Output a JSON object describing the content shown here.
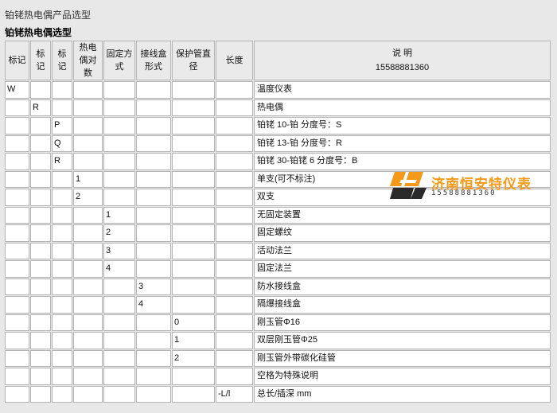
{
  "page_title": "铂铑热电偶产品选型",
  "sub_title": "铂铑热电偶选型",
  "headers": {
    "mark1": "标记",
    "mark2": "标记",
    "mark3": "标记",
    "pairs": "热电偶对数",
    "fixing": "固定方式",
    "junction": "接线盒形式",
    "tube": "保护管直径",
    "length": "长度",
    "desc_label": "说  明",
    "desc_phone": "15588881360"
  },
  "rows": [
    {
      "c1": "W",
      "c2": "",
      "c3": "",
      "c4": "",
      "c5": "",
      "c6": "",
      "c7": "",
      "c8": "",
      "desc": "温度仪表"
    },
    {
      "c1": "",
      "c2": "R",
      "c3": "",
      "c4": "",
      "c5": "",
      "c6": "",
      "c7": "",
      "c8": "",
      "desc": "热电偶"
    },
    {
      "c1": "",
      "c2": "",
      "c3": "P",
      "c4": "",
      "c5": "",
      "c6": "",
      "c7": "",
      "c8": "",
      "desc": "铂铑 10-铂  分度号：S"
    },
    {
      "c1": "",
      "c2": "",
      "c3": "Q",
      "c4": "",
      "c5": "",
      "c6": "",
      "c7": "",
      "c8": "",
      "desc": "铂铑 13-铂  分度号：R"
    },
    {
      "c1": "",
      "c2": "",
      "c3": "R",
      "c4": "",
      "c5": "",
      "c6": "",
      "c7": "",
      "c8": "",
      "desc": "铂铑 30-铂铑 6  分度号：B"
    },
    {
      "c1": "",
      "c2": "",
      "c3": "",
      "c4": "1",
      "c5": "",
      "c6": "",
      "c7": "",
      "c8": "",
      "desc": "单支(可不标注)"
    },
    {
      "c1": "",
      "c2": "",
      "c3": "",
      "c4": "2",
      "c5": "",
      "c6": "",
      "c7": "",
      "c8": "",
      "desc": "双支"
    },
    {
      "c1": "",
      "c2": "",
      "c3": "",
      "c4": "",
      "c5": "1",
      "c6": "",
      "c7": "",
      "c8": "",
      "desc": "无固定装置"
    },
    {
      "c1": "",
      "c2": "",
      "c3": "",
      "c4": "",
      "c5": "2",
      "c6": "",
      "c7": "",
      "c8": "",
      "desc": "固定螺纹"
    },
    {
      "c1": "",
      "c2": "",
      "c3": "",
      "c4": "",
      "c5": "3",
      "c6": "",
      "c7": "",
      "c8": "",
      "desc": "活动法兰"
    },
    {
      "c1": "",
      "c2": "",
      "c3": "",
      "c4": "",
      "c5": "4",
      "c6": "",
      "c7": "",
      "c8": "",
      "desc": "固定法兰"
    },
    {
      "c1": "",
      "c2": "",
      "c3": "",
      "c4": "",
      "c5": "",
      "c6": "3",
      "c7": "",
      "c8": "",
      "desc": "防水接线盒"
    },
    {
      "c1": "",
      "c2": "",
      "c3": "",
      "c4": "",
      "c5": "",
      "c6": "4",
      "c7": "",
      "c8": "",
      "desc": "隔爆接线盒"
    },
    {
      "c1": "",
      "c2": "",
      "c3": "",
      "c4": "",
      "c5": "",
      "c6": "",
      "c7": "0",
      "c8": "",
      "desc": "刚玉管Φ16"
    },
    {
      "c1": "",
      "c2": "",
      "c3": "",
      "c4": "",
      "c5": "",
      "c6": "",
      "c7": "1",
      "c8": "",
      "desc": "双层刚玉管Φ25"
    },
    {
      "c1": "",
      "c2": "",
      "c3": "",
      "c4": "",
      "c5": "",
      "c6": "",
      "c7": "2",
      "c8": "",
      "desc": "刚玉管外带碳化硅管"
    },
    {
      "c1": "",
      "c2": "",
      "c3": "",
      "c4": "",
      "c5": "",
      "c6": "",
      "c7": "",
      "c8": "",
      "desc": "空格为特殊说明"
    },
    {
      "c1": "",
      "c2": "",
      "c3": "",
      "c4": "",
      "c5": "",
      "c6": "",
      "c7": "",
      "c8": "-L/l",
      "desc": "总长/插深 mm"
    }
  ],
  "watermark": {
    "name": "济南恒安特仪表",
    "phone": "15588881360",
    "logo_icon": "hengan-logo-icon",
    "accent_color": "#f39a1b"
  }
}
